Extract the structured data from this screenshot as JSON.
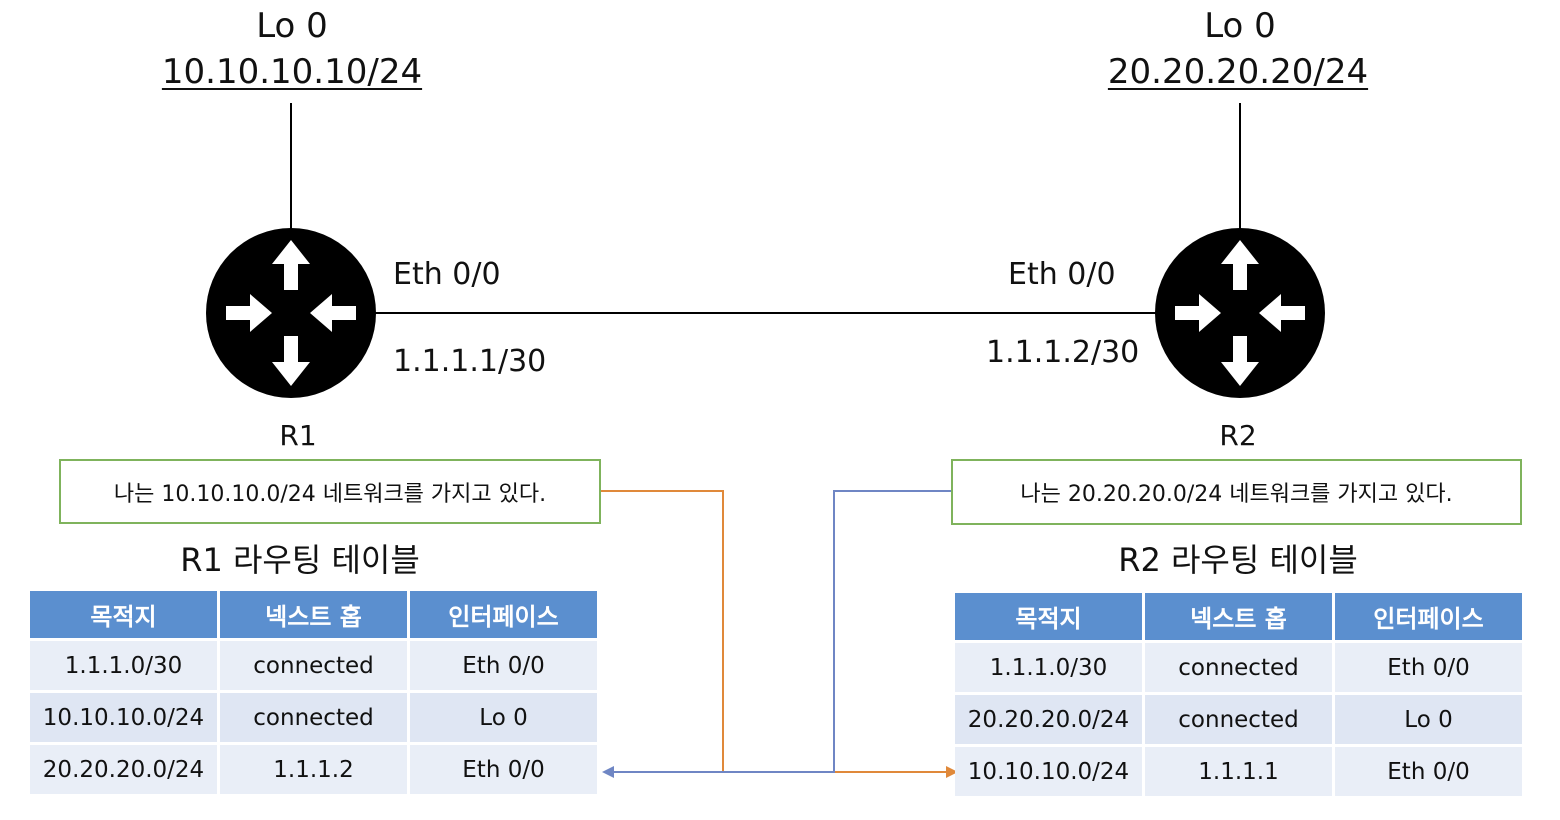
{
  "r1": {
    "name": "R1",
    "loopback": {
      "label": "Lo 0",
      "address": "10.10.10.10/24"
    },
    "interface": {
      "label": "Eth 0/0",
      "address": "1.1.1.1/30"
    },
    "note": "나는 10.10.10.0/24 네트워크를 가지고 있다.",
    "table_title": "R1 라우팅 테이블",
    "headers": [
      "목적지",
      "넥스트 홉",
      "인터페이스"
    ],
    "rows": [
      [
        "1.1.1.0/30",
        "connected",
        "Eth 0/0"
      ],
      [
        "10.10.10.0/24",
        "connected",
        "Lo 0"
      ],
      [
        "20.20.20.0/24",
        "1.1.1.2",
        "Eth 0/0"
      ]
    ]
  },
  "r2": {
    "name": "R2",
    "loopback": {
      "label": "Lo 0",
      "address": "20.20.20.20/24"
    },
    "interface": {
      "label": "Eth 0/0",
      "address": "1.1.1.2/30"
    },
    "note": "나는 20.20.20.0/24 네트워크를 가지고 있다.",
    "table_title": "R2 라우팅 테이블",
    "headers": [
      "목적지",
      "넥스트 홉",
      "인터페이스"
    ],
    "rows": [
      [
        "1.1.1.0/30",
        "connected",
        "Eth 0/0"
      ],
      [
        "20.20.20.0/24",
        "connected",
        "Lo 0"
      ],
      [
        "10.10.10.0/24",
        "1.1.1.1",
        "Eth 0/0"
      ]
    ]
  },
  "colors": {
    "router": "#000000",
    "note_border": "#7fb35c",
    "table_header": "#5b8fcf",
    "r1_advert_arrow": "#e0893a",
    "r2_advert_arrow": "#6f86c4"
  },
  "icons": {
    "router": "router-icon"
  }
}
